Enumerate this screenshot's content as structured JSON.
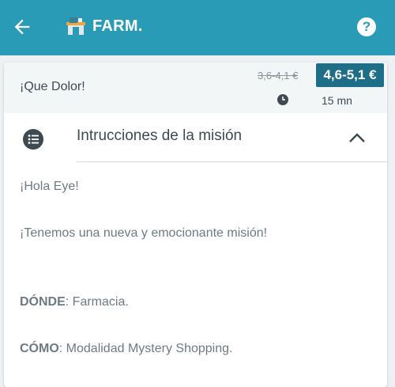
{
  "appbar": {
    "title": "FARM.",
    "icons": {
      "back": "arrow-left-icon",
      "logo": "pharmacy-logo-icon",
      "help": "help-icon"
    },
    "help_glyph": "?"
  },
  "mission": {
    "name": "¡Que Dolor!",
    "old_price": "3,6-4,1 €",
    "price": "4,6-5,1 €",
    "duration": "15 mn"
  },
  "instructions": {
    "title": "Intrucciones de la misión",
    "greeting": "¡Hola Eye!",
    "announcement": "¡Tenemos una nueva y emocionante misión!",
    "where_label": "DÓNDE",
    "where_value": ": Farmacia.",
    "how_label": "CÓMO",
    "how_value": ": Modalidad Mystery Shopping."
  },
  "colors": {
    "appbar": "#2a9bb6",
    "price_badge": "#1e6e88",
    "text": "#3d4a52",
    "body_text": "#6e7a83"
  }
}
